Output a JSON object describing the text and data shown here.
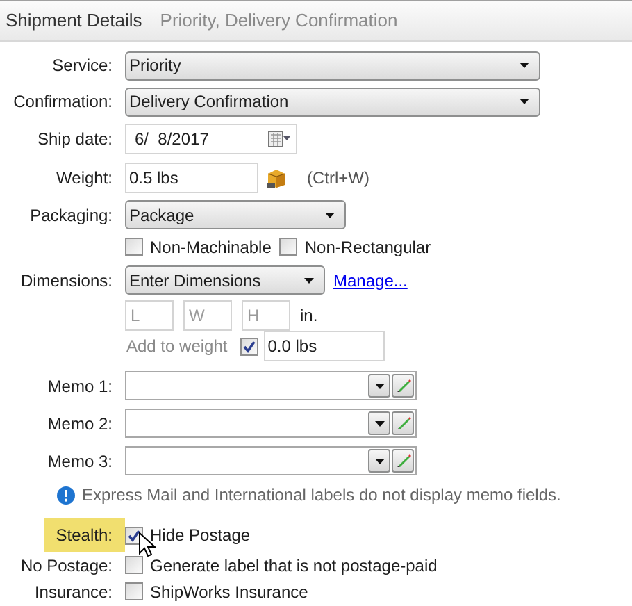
{
  "header": {
    "title": "Shipment Details",
    "summary": "Priority, Delivery Confirmation"
  },
  "service": {
    "label": "Service:",
    "value": "Priority"
  },
  "confirmation": {
    "label": "Confirmation:",
    "value": "Delivery Confirmation"
  },
  "ship_date": {
    "label": "Ship date:",
    "value": "6/  8/2017"
  },
  "weight": {
    "label": "Weight:",
    "value": "0.5 lbs",
    "shortcut": "(Ctrl+W)"
  },
  "packaging": {
    "label": "Packaging:",
    "value": "Package"
  },
  "packaging_options": [
    {
      "label": "Non-Machinable",
      "checked": false
    },
    {
      "label": "Non-Rectangular",
      "checked": false
    }
  ],
  "dimensions": {
    "label": "Dimensions:",
    "value": "Enter Dimensions",
    "link": "Manage...",
    "placeholders": [
      "L",
      "W",
      "H"
    ],
    "unit": "in.",
    "add_to_weight": {
      "label": "Add to weight",
      "checked": true,
      "value": "0.0 lbs"
    }
  },
  "memos": [
    {
      "label": "Memo 1:"
    },
    {
      "label": "Memo 2:"
    },
    {
      "label": "Memo 3:"
    }
  ],
  "memo_note": "Express Mail and International labels do not display memo fields.",
  "options": [
    {
      "label": "Stealth:",
      "text": "Hide Postage",
      "checked": true,
      "highlighted": true,
      "hovered": true
    },
    {
      "label": "No Postage:",
      "text": "Generate label that is not postage-paid",
      "checked": false,
      "highlighted": false,
      "hovered": false
    },
    {
      "label": "Insurance:",
      "text": "ShipWorks Insurance",
      "checked": false,
      "highlighted": false,
      "hovered": false
    }
  ]
}
